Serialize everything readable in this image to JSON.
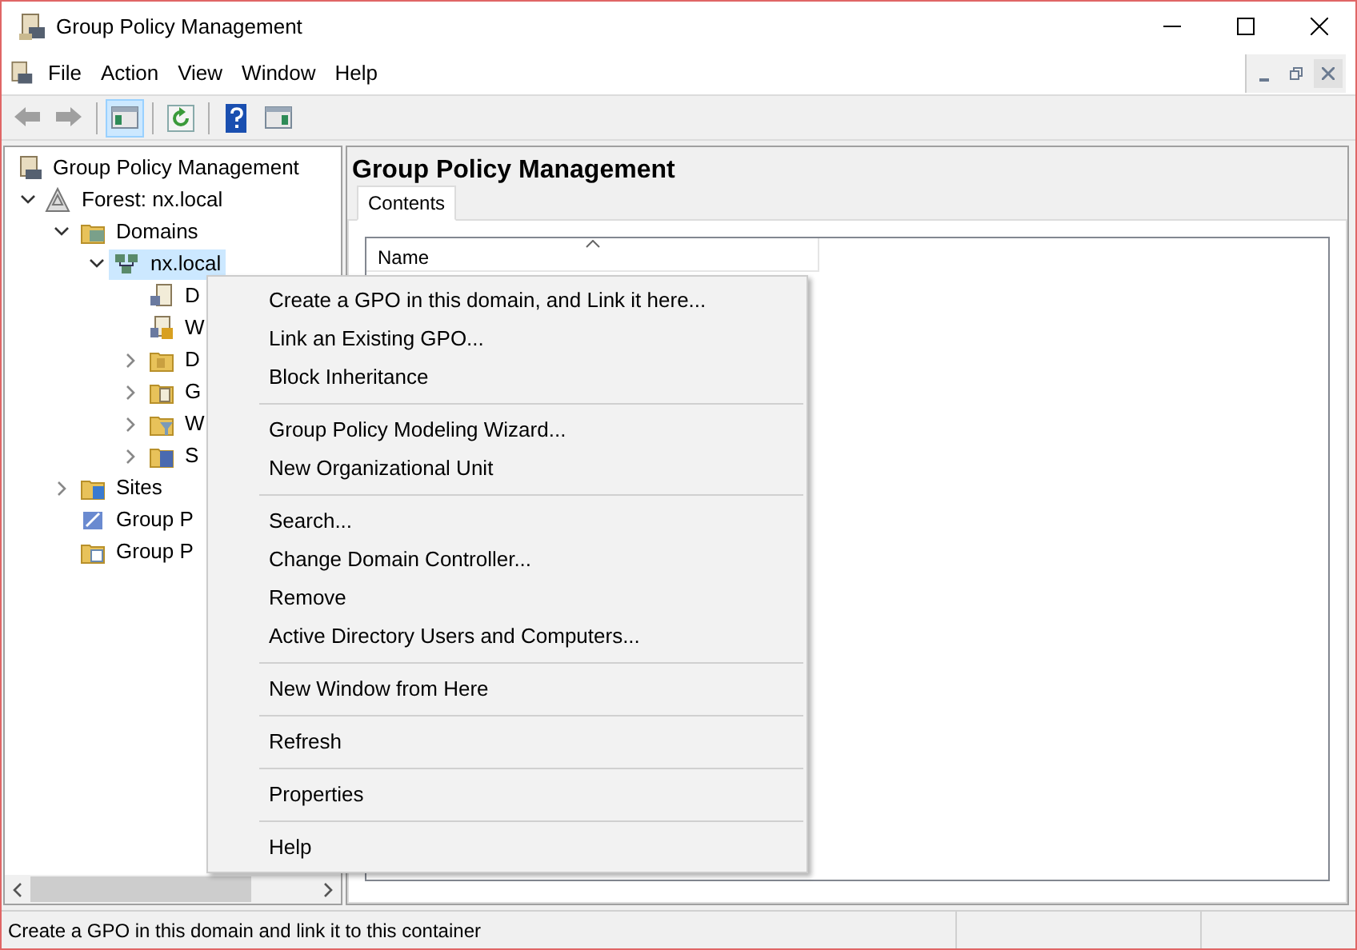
{
  "window": {
    "title": "Group Policy Management"
  },
  "menu_bar": [
    "File",
    "Action",
    "View",
    "Window",
    "Help"
  ],
  "toolbar": [
    {
      "kind": "back",
      "disabled": true,
      "pressed": false
    },
    {
      "kind": "forward",
      "disabled": true,
      "pressed": false
    },
    {
      "kind": "separator"
    },
    {
      "kind": "console-tree",
      "disabled": false,
      "pressed": true
    },
    {
      "kind": "separator"
    },
    {
      "kind": "refresh",
      "disabled": false,
      "pressed": false
    },
    {
      "kind": "separator"
    },
    {
      "kind": "help",
      "disabled": false,
      "pressed": false
    },
    {
      "kind": "action-pane",
      "disabled": false,
      "pressed": false
    }
  ],
  "tree": [
    {
      "label": "Group Policy Management",
      "kind": "root",
      "selected": false,
      "children": [
        {
          "label": "Forest: nx.local",
          "kind": "forest",
          "expanded": true,
          "selected": false,
          "children": [
            {
              "label": "Domains",
              "kind": "domains",
              "expanded": true,
              "selected": false,
              "children": [
                {
                  "label": "nx.local",
                  "kind": "domain",
                  "expanded": true,
                  "selected": true,
                  "children": [
                    {
                      "label": "D",
                      "kind": "gpo-link",
                      "selected": false
                    },
                    {
                      "label": "W",
                      "kind": "gpo-lock",
                      "selected": false
                    },
                    {
                      "label": "D",
                      "kind": "ou",
                      "expanded": false,
                      "selected": false
                    },
                    {
                      "label": "G",
                      "kind": "gpo-folder",
                      "expanded": false,
                      "selected": false
                    },
                    {
                      "label": "W",
                      "kind": "filter-folder",
                      "expanded": false,
                      "selected": false
                    },
                    {
                      "label": "S",
                      "kind": "starter-folder",
                      "expanded": false,
                      "selected": false
                    }
                  ]
                }
              ]
            },
            {
              "label": "Sites",
              "kind": "sites",
              "expanded": false,
              "selected": false
            },
            {
              "label": "Group P",
              "kind": "modeling",
              "selected": false
            },
            {
              "label": "Group P",
              "kind": "results",
              "selected": false
            }
          ]
        }
      ]
    }
  ],
  "details": {
    "title": "Group Policy Management",
    "tabs": [
      {
        "label": "Contents",
        "selected": true
      }
    ],
    "columns": [
      {
        "label": "Name",
        "sorted": true
      }
    ]
  },
  "context_menu": [
    {
      "kind": "item",
      "label": "Create a GPO in this domain, and Link it here..."
    },
    {
      "kind": "item",
      "label": "Link an Existing GPO..."
    },
    {
      "kind": "item",
      "label": "Block Inheritance"
    },
    {
      "kind": "separator"
    },
    {
      "kind": "item",
      "label": "Group Policy Modeling Wizard..."
    },
    {
      "kind": "item",
      "label": "New Organizational Unit"
    },
    {
      "kind": "separator"
    },
    {
      "kind": "item",
      "label": "Search..."
    },
    {
      "kind": "item",
      "label": "Change Domain Controller..."
    },
    {
      "kind": "item",
      "label": "Remove"
    },
    {
      "kind": "item",
      "label": "Active Directory Users and Computers..."
    },
    {
      "kind": "separator"
    },
    {
      "kind": "item",
      "label": "New Window from Here"
    },
    {
      "kind": "separator"
    },
    {
      "kind": "item",
      "label": "Refresh"
    },
    {
      "kind": "separator"
    },
    {
      "kind": "item",
      "label": "Properties"
    },
    {
      "kind": "separator"
    },
    {
      "kind": "item",
      "label": "Help"
    }
  ],
  "status_bar": {
    "text": "Create a GPO in this domain and link it to this container"
  }
}
